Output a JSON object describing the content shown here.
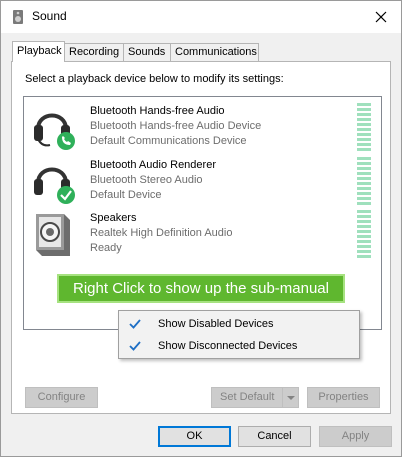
{
  "window": {
    "title": "Sound"
  },
  "tabs": [
    {
      "label": "Playback"
    },
    {
      "label": "Recording"
    },
    {
      "label": "Sounds"
    },
    {
      "label": "Communications"
    }
  ],
  "instruction": "Select a playback device below to modify its settings:",
  "devices": [
    {
      "name": "Bluetooth Hands-free Audio",
      "description": "Bluetooth Hands-free Audio Device",
      "status": "Default Communications Device",
      "icon": "headset-icon",
      "badge": "phone-badge-icon"
    },
    {
      "name": "Bluetooth Audio Renderer",
      "description": "Bluetooth Stereo Audio",
      "status": "Default Device",
      "icon": "headset-icon",
      "badge": "check-badge-icon"
    },
    {
      "name": "Speakers",
      "description": "Realtek High Definition Audio",
      "status": "Ready",
      "icon": "speaker-icon"
    }
  ],
  "annotation": "Right Click to show up the sub-manual",
  "context_menu": {
    "items": [
      {
        "label": "Show Disabled Devices",
        "checked": true
      },
      {
        "label": "Show Disconnected Devices",
        "checked": true
      }
    ]
  },
  "panel_buttons": {
    "configure": "Configure",
    "set_default": "Set Default",
    "properties": "Properties"
  },
  "dialog_buttons": {
    "ok": "OK",
    "cancel": "Cancel",
    "apply": "Apply"
  },
  "colors": {
    "accent": "#0078d7",
    "annotation_bg": "#5fb72f",
    "meter_green": "#9fe0bd",
    "badge_green": "#2fb05a"
  }
}
